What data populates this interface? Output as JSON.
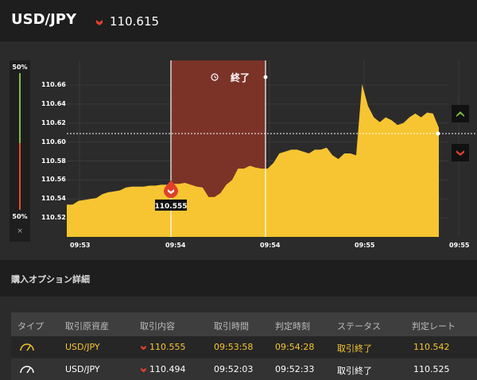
{
  "header": {
    "pair": "USD/JPY",
    "rate": "110.615",
    "direction_icon": "down-arrow-icon"
  },
  "meter": {
    "top_label": "50%",
    "bottom_label": "50%",
    "close_label": "×"
  },
  "chart": {
    "end_label": "終了",
    "entry_price_tag": "110.555",
    "y_ticks": [
      "110.66",
      "110.64",
      "110.62",
      "110.60",
      "110.58",
      "110.56",
      "110.54",
      "110.52"
    ],
    "x_ticks": [
      "09:53",
      "09:54",
      "09:54",
      "09:55",
      "09:55"
    ],
    "colors": {
      "area": "#f7c531",
      "expired_zone": "#7b3328",
      "up": "#7cc242",
      "down": "#e0402a"
    }
  },
  "chart_data": {
    "type": "area",
    "series": [
      {
        "values": [
          110.534,
          110.534,
          110.538,
          110.539,
          110.54,
          110.541,
          110.545,
          110.547,
          110.548,
          110.549,
          110.552,
          110.553,
          110.553,
          110.553,
          110.554,
          110.554,
          110.555,
          110.555,
          110.556,
          110.556,
          110.557,
          110.555,
          110.553,
          110.552,
          110.542,
          110.542,
          110.546,
          110.555,
          110.56,
          110.572,
          110.572,
          110.575,
          110.573,
          110.572,
          110.572,
          110.578,
          110.588,
          110.59,
          110.592,
          110.592,
          110.59,
          110.588,
          110.592,
          110.592,
          110.594,
          110.586,
          110.582,
          110.588,
          110.588,
          110.586,
          110.661,
          110.638,
          110.626,
          110.621,
          110.626,
          110.623,
          110.618,
          110.62,
          110.626,
          110.63,
          110.626,
          110.631,
          110.63,
          110.615
        ]
      }
    ],
    "ylim": [
      110.5,
      110.686
    ],
    "y_ticks": [
      110.52,
      110.54,
      110.56,
      110.58,
      110.6,
      110.62,
      110.64,
      110.66
    ],
    "x_ticks": [
      "09:53",
      "09:54",
      "09:54",
      "09:55",
      "09:55"
    ],
    "current_rate": 110.615,
    "entry_rate": 110.555
  },
  "section": {
    "title": "購入オプション詳細"
  },
  "table": {
    "headers": [
      "タイプ",
      "取引原資産",
      "取引内容",
      "取引時間",
      "判定時刻",
      "ステータス",
      "判定レート"
    ],
    "rows": [
      {
        "asset": "USD/JPY",
        "content": "110.555",
        "time": "09:53:58",
        "judge_time": "09:54:28",
        "status": "取引終了",
        "judge_rate": "110.542"
      },
      {
        "asset": "USD/JPY",
        "content": "110.494",
        "time": "09:52:03",
        "judge_time": "09:52:33",
        "status": "取引終了",
        "judge_rate": "110.525"
      }
    ]
  }
}
